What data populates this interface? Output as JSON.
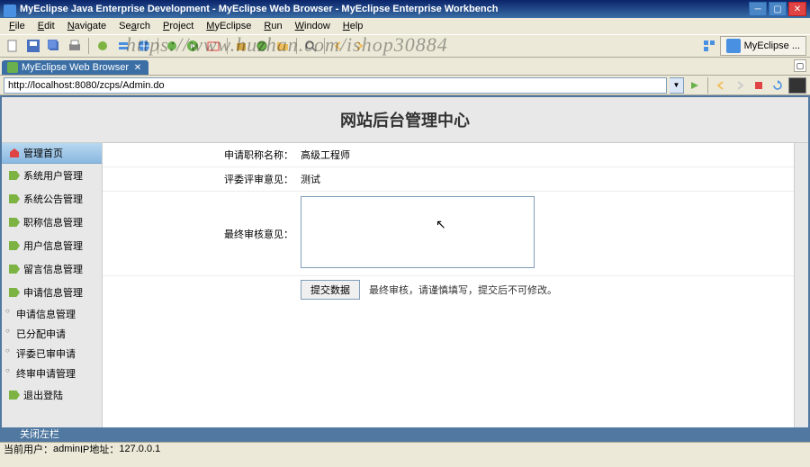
{
  "window": {
    "title": "MyEclipse Java Enterprise Development - MyEclipse Web Browser - MyEclipse Enterprise Workbench"
  },
  "watermark": "https://www.huzhan.com/ishop30884",
  "menu": {
    "file": "File",
    "edit": "Edit",
    "navigate": "Navigate",
    "search": "Search",
    "project": "Project",
    "myeclipse": "MyEclipse",
    "run": "Run",
    "window": "Window",
    "help": "Help"
  },
  "perspective": {
    "label": "MyEclipse ..."
  },
  "tab": {
    "label": "MyEclipse Web Browser"
  },
  "address": {
    "url": "http://localhost:8080/zcps/Admin.do"
  },
  "page": {
    "title": "网站后台管理中心",
    "nav_header": "管理首页",
    "nav": [
      "系统用户管理",
      "系统公告管理",
      "职称信息管理",
      "用户信息管理",
      "留言信息管理",
      "申请信息管理"
    ],
    "sub": [
      "申请信息管理",
      "已分配申请",
      "评委已审申请",
      "终审申请管理"
    ],
    "logout": "退出登陆",
    "form": {
      "title_label": "申请职称名称：",
      "title_value": "高级工程师",
      "review_label": "评委评审意见：",
      "review_value": "测试",
      "final_label": "最终审核意见：",
      "final_value": "",
      "submit": "提交数据",
      "note": "最终审核，请谨慎填写，提交后不可修改。"
    },
    "footer": "关闭左栏"
  },
  "status": {
    "user_label": "当前用户：",
    "user": "admin",
    "ip_label": " IP地址：",
    "ip": "127.0.0.1"
  }
}
